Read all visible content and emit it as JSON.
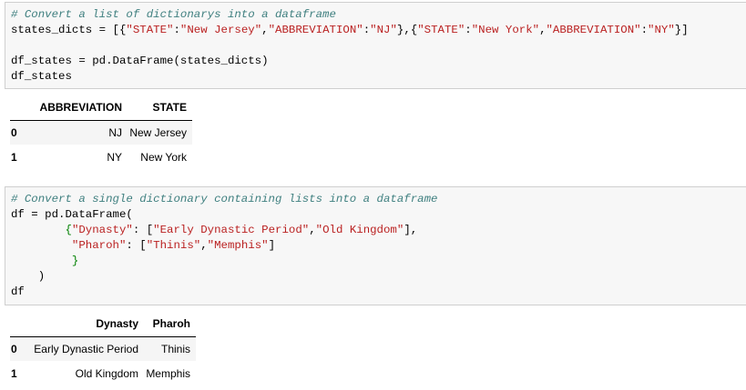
{
  "cell1": {
    "comment": "# Convert a list of dictionarys into a dataframe",
    "line2_name": "states_dicts",
    "s_state1": "\"STATE\"",
    "s_nj": "\"New Jersey\"",
    "s_abbr1": "\"ABBREVIATION\"",
    "s_nj_abbr": "\"NJ\"",
    "s_state2": "\"STATE\"",
    "s_ny": "\"New York\"",
    "s_abbr2": "\"ABBREVIATION\"",
    "s_ny_abbr": "\"NY\"",
    "line4": "df_states = pd.DataFrame(states_dicts)",
    "line5": "df_states"
  },
  "table1": {
    "headers": [
      "",
      "ABBREVIATION",
      "STATE"
    ],
    "rows": [
      [
        "0",
        "NJ",
        "New Jersey"
      ],
      [
        "1",
        "NY",
        "New York"
      ]
    ]
  },
  "cell2": {
    "comment": "# Convert a single dictionary containing lists into a dataframe",
    "line2": "df = pd.DataFrame(",
    "k_dynasty": "\"Dynasty\"",
    "v_dyn1": "\"Early Dynastic Period\"",
    "v_dyn2": "\"Old Kingdom\"",
    "k_pharoh": "\"Pharoh\"",
    "v_ph1": "\"Thinis\"",
    "v_ph2": "\"Memphis\"",
    "line7": "df"
  },
  "table2": {
    "headers": [
      "",
      "Dynasty",
      "Pharoh"
    ],
    "rows": [
      [
        "0",
        "Early Dynastic Period",
        "Thinis"
      ],
      [
        "1",
        "Old Kingdom",
        "Memphis"
      ]
    ]
  }
}
